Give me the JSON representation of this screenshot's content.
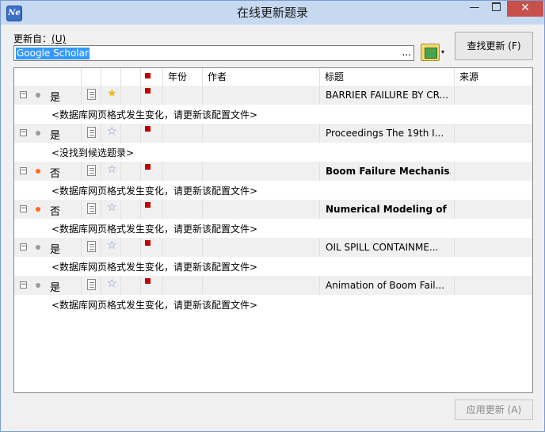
{
  "window": {
    "icon_text": "Ne",
    "title": "在线更新题录",
    "min_glyph": "—",
    "close_glyph": "✕"
  },
  "form": {
    "update_from_label": "更新自：",
    "update_from_shortcut": "(U)",
    "source_value": "Google Scholar",
    "browse_label": "...",
    "db_dropdown_arrow": "▾",
    "find_button": "查找更新 (F)",
    "apply_button": "应用更新 (A)"
  },
  "table": {
    "columns": [
      "",
      "",
      "",
      "",
      "",
      "年份",
      "作者",
      "标题",
      "来源"
    ],
    "rows": [
      {
        "status": "是",
        "dot": "grey",
        "starred": true,
        "star_glyph": "★",
        "title": "BARRIER FAILURE BY CR...",
        "title_bold": false,
        "note": "<数据库网页格式发生变化，请更新该配置文件>"
      },
      {
        "status": "是",
        "dot": "grey",
        "starred": false,
        "star_glyph": "☆",
        "title": "Proceedings The 19th I...",
        "title_bold": false,
        "note": "<没找到候选题录>"
      },
      {
        "status": "否",
        "dot": "orange",
        "starred": false,
        "star_glyph": "☆",
        "title": "Boom Failure Mechanis...",
        "title_bold": true,
        "note": "<数据库网页格式发生变化，请更新该配置文件>"
      },
      {
        "status": "否",
        "dot": "orange",
        "starred": false,
        "star_glyph": "☆",
        "title": "Numerical Modeling of ...",
        "title_bold": true,
        "note": "<数据库网页格式发生变化，请更新该配置文件>"
      },
      {
        "status": "是",
        "dot": "grey",
        "starred": false,
        "star_glyph": "☆",
        "title": "OIL SPILL CONTAINME...",
        "title_bold": false,
        "note": "<数据库网页格式发生变化，请更新该配置文件>"
      },
      {
        "status": "是",
        "dot": "grey",
        "starred": false,
        "star_glyph": "☆",
        "title": "Animation of Boom Fail...",
        "title_bold": false,
        "note": "<数据库网页格式发生变化，请更新该配置文件>"
      }
    ]
  },
  "colors": {
    "titlebar": "#c6d9f1",
    "close": "#c7504a",
    "selection": "#3399ff",
    "dot_no": "#ff6a1a",
    "dot_yes": "#9a9a9a",
    "flag": "#c00000"
  }
}
